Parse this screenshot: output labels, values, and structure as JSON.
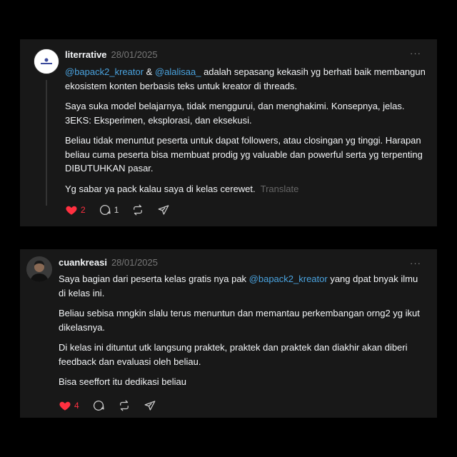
{
  "posts": [
    {
      "username": "literrative",
      "date": "28/01/2025",
      "more": "···",
      "first_line": {
        "mention1": "@bapack2_kreator",
        "connector": " & ",
        "mention2": "@alalisaa_",
        "rest": " adalah sepasang kekasih yg berhati baik membangun ekosistem konten berbasis teks untuk kreator di threads."
      },
      "paragraphs": [
        "Saya suka model belajarnya, tidak menggurui, dan menghakimi. Konsepnya, jelas. 3EKS: Eksperimen, eksplorasi, dan eksekusi.",
        "Beliau tidak menuntut peserta untuk dapat followers, atau closingan yg tinggi. Harapan beliau cuma peserta bisa membuat prodig yg valuable dan powerful serta yg terpenting DIBUTUHKAN pasar."
      ],
      "last_para": "Yg sabar ya pack kalau saya di kelas cerewet.",
      "translate": "Translate",
      "likes": "2",
      "replies": "1"
    },
    {
      "username": "cuankreasi",
      "date": "28/01/2025",
      "more": "···",
      "first_line": {
        "before": "Saya bagian dari peserta kelas gratis nya pak ",
        "mention": "@bapack2_kreator",
        "after": " yang dpat bnyak ilmu di kelas ini."
      },
      "paragraphs": [
        "Beliau sebisa mngkin slalu terus menuntun dan memantau perkembangan orng2 yg ikut dikelasnya.",
        "Di kelas ini dituntut utk langsung praktek, praktek dan praktek dan diakhir akan diberi feedback dan evaluasi oleh beliau.",
        "Bisa seeffort itu dedikasi beliau"
      ],
      "likes": "4"
    }
  ],
  "colors": {
    "background": "#000000",
    "card": "#181818",
    "mention": "#4aa3df",
    "like": "#ff3040",
    "muted": "#777777"
  }
}
